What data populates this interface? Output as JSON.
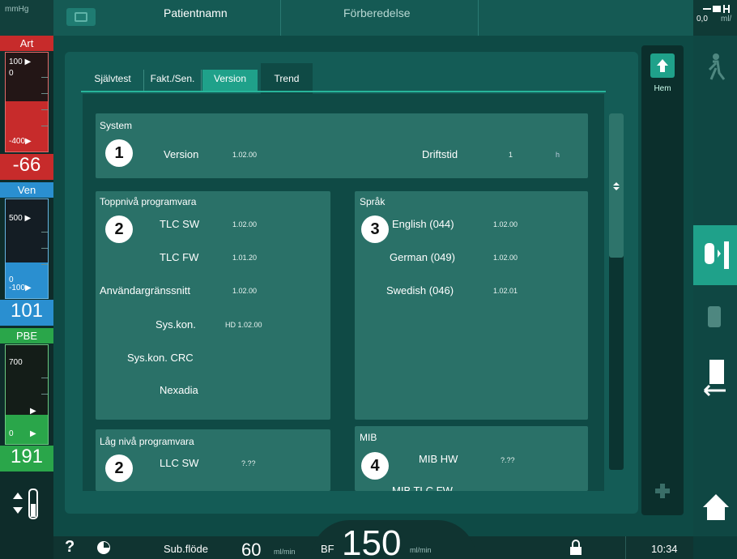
{
  "top": {
    "title": "Patientnamn",
    "status": "Förberedelse",
    "unit": "mmHg",
    "right_top": "0,0",
    "right_unit": "ml/"
  },
  "gauges": {
    "art": {
      "label": "Art",
      "top_mark": "100 ▶",
      "zero": "0",
      "low_mark": "-400▶",
      "value": "-66"
    },
    "ven": {
      "label": "Ven",
      "top_mark": "500 ▶",
      "zero": "0",
      "low_mark": "-100▶",
      "value": "101"
    },
    "pbe": {
      "label": "PBE",
      "top_mark": "700",
      "zero": "0",
      "value": "191"
    }
  },
  "tabs": [
    {
      "label": "Självtest"
    },
    {
      "label": "Fakt./Sen."
    },
    {
      "label": "Version"
    },
    {
      "label": "Trend"
    }
  ],
  "active_tab": "Version",
  "system": {
    "header": "System",
    "version_label": "Version",
    "version_value": "1.02.00",
    "uptime_label": "Driftstid",
    "uptime_value": "1",
    "uptime_unit": "h"
  },
  "top_sw": {
    "header": "Toppnivå programvara",
    "rows": [
      {
        "label": "TLC SW",
        "value": "1.02.00"
      },
      {
        "label": "TLC FW",
        "value": "1.01.20"
      },
      {
        "label": "Användargränssnitt",
        "value": "1.02.00"
      },
      {
        "label": "Sys.kon.",
        "value": "HD 1.02.00"
      },
      {
        "label": "Sys.kon. CRC",
        "value": ""
      },
      {
        "label": "Nexadia",
        "value": ""
      }
    ]
  },
  "lang": {
    "header": "Språk",
    "rows": [
      {
        "label": "English (044)",
        "value": "1.02.00"
      },
      {
        "label": "German (049)",
        "value": "1.02.00"
      },
      {
        "label": "Swedish (046)",
        "value": "1.02.01"
      }
    ]
  },
  "low_sw": {
    "header": "Låg nivå programvara",
    "rows": [
      {
        "label": "LLC SW",
        "value": "?.??"
      }
    ]
  },
  "mib": {
    "header": "MIB",
    "rows": [
      {
        "label": "MIB HW",
        "value": "?.??"
      },
      {
        "label": "MIB TLC FW",
        "value": ""
      }
    ]
  },
  "callouts": [
    "1",
    "2",
    "3",
    "2",
    "4"
  ],
  "home_label": "Hem",
  "bottom": {
    "help": "?",
    "subflow_label": "Sub.flöde",
    "subflow_value": "60",
    "subflow_unit": "ml/min",
    "bf_label": "BF",
    "bf_value": "150",
    "bf_unit": "ml/min",
    "time": "10:34"
  },
  "colors": {
    "accent": "#1fa18a",
    "art": "#c72b2b",
    "ven": "#2a8fd0",
    "pbe": "#2aa64a"
  }
}
